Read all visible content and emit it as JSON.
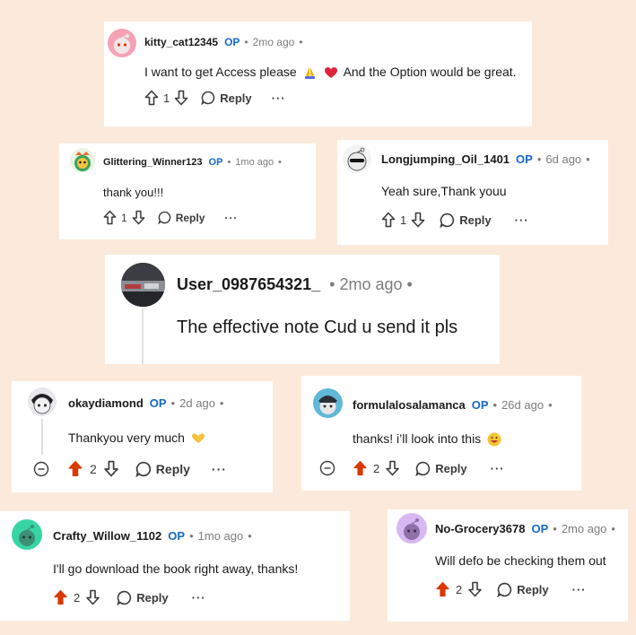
{
  "comments": [
    {
      "username": "kitty_cat12345",
      "op": "OP",
      "time": "2mo ago",
      "text_before": "I want to get Access please",
      "text_after": "And the Option would be great.",
      "votes": "1",
      "reply": "Reply",
      "more": "···"
    },
    {
      "username": "Glittering_Winner123",
      "op": "OP",
      "time": "1mo ago",
      "text": "thank you!!!",
      "votes": "1",
      "reply": "Reply",
      "more": "···"
    },
    {
      "username": "Longjumping_Oil_1401",
      "op": "OP",
      "time": "6d ago",
      "text": "Yeah sure,Thank youu",
      "votes": "1",
      "reply": "Reply",
      "more": "···"
    },
    {
      "username": "User_0987654321_",
      "time": "2mo ago",
      "text": "The effective note Cud u send it pls"
    },
    {
      "username": "okaydiamond",
      "op": "OP",
      "time": "2d ago",
      "text": "Thankyou very much",
      "votes": "2",
      "reply": "Reply",
      "more": "···"
    },
    {
      "username": "formulalosalamanca",
      "op": "OP",
      "time": "26d ago",
      "text": "thanks! i’ll look into this",
      "votes": "2",
      "reply": "Reply",
      "more": "···"
    },
    {
      "username": "Crafty_Willow_1102",
      "op": "OP",
      "time": "1mo ago",
      "text": "I'll go download the book right away, thanks!",
      "votes": "2",
      "reply": "Reply",
      "more": "···"
    },
    {
      "username": "No-Grocery3678",
      "op": "OP",
      "time": "2mo ago",
      "text": "Will defo be checking them out",
      "votes": "2",
      "reply": "Reply",
      "more": "···"
    }
  ],
  "sep": "•",
  "colors": {
    "background": "#fbeadb",
    "op": "#1668c8",
    "upvote_active": "#d93900",
    "meta": "#7c7c7c"
  }
}
